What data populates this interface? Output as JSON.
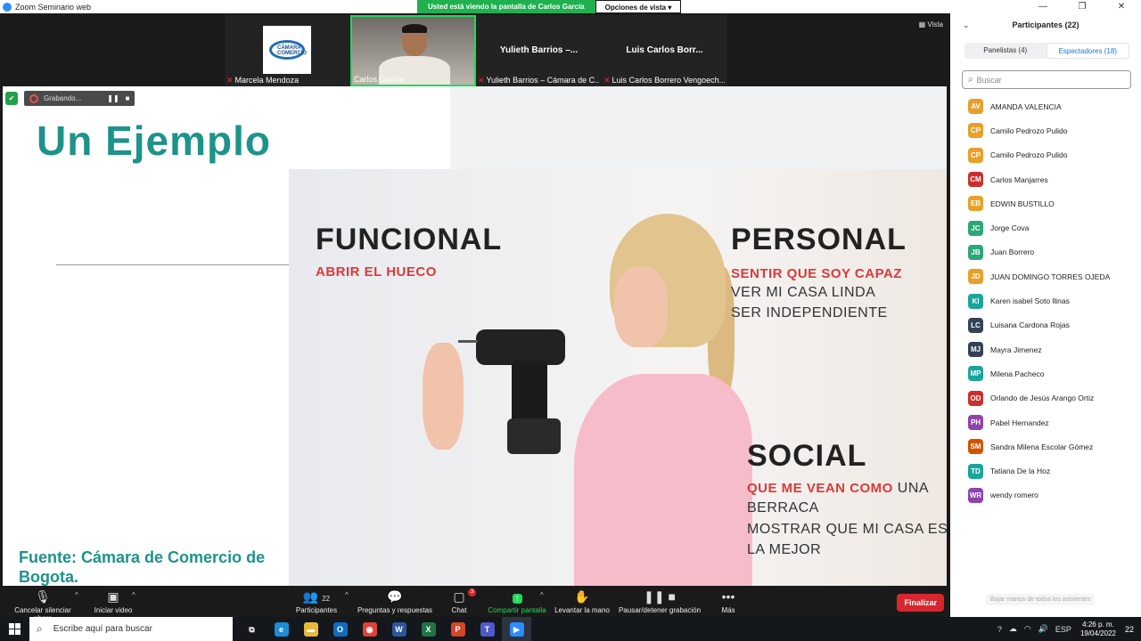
{
  "window": {
    "title": "Zoom Seminario web",
    "controls": [
      "—",
      "❐",
      "✕"
    ]
  },
  "share_bar": {
    "viewing": "Usted está viendo la pantalla de Carlos García",
    "view_options": "Opciones de vista ▾"
  },
  "vista_label": "Vista",
  "thumbnails": [
    {
      "name": "Marcela Mendoza",
      "muted": true,
      "type": "logo",
      "logo_text": "CÁMARA COMERCIO"
    },
    {
      "name": "Carlos García",
      "muted": false,
      "type": "video"
    },
    {
      "name": "Yulieth Barrios – Cámara de C...",
      "big_label": "Yulieth  Barrios –...",
      "muted": true,
      "type": "name"
    },
    {
      "name": "Luis Carlos Borrero Vengoech...",
      "big_label": "Luis Carlos Borr...",
      "muted": true,
      "type": "name"
    }
  ],
  "recording": {
    "label": "Grabando...",
    "pause": "❚❚",
    "stop": "■"
  },
  "slide": {
    "title": "Un Ejemplo",
    "source": "Fuente: Cámara de Comercio de Bogota.",
    "funcional": {
      "heading": "FUNCIONAL",
      "lines": [
        "ABRIR EL HUECO"
      ]
    },
    "personal": {
      "heading": "PERSONAL",
      "red": "SENTIR QUE SOY CAPAZ",
      "lines": [
        "VER MI CASA LINDA",
        "SER INDEPENDIENTE"
      ]
    },
    "social": {
      "heading": "SOCIAL",
      "red": "QUE ME VEAN COMO",
      "red_rest": " UNA",
      "lines": [
        "BERRACA",
        "MOSTRAR QUE MI CASA ES",
        "LA MEJOR"
      ]
    }
  },
  "toolbar": {
    "mute": "Cancelar silenciar ahora",
    "video": "Iniciar video",
    "participants": "Participantes",
    "participants_count": "22",
    "qa": "Preguntas y respuestas",
    "chat": "Chat",
    "chat_badge": "3",
    "share": "Compartir pantalla",
    "raise_hand": "Levantar la mano",
    "pause_rec": "Pausar/detener grabación",
    "more": "Más",
    "end": "Finalizar"
  },
  "panel": {
    "title": "Participantes (22)",
    "tabs": [
      {
        "label": "Panelistas (4)",
        "active": false
      },
      {
        "label": "Espectadores (18)",
        "active": true
      }
    ],
    "search_placeholder": "Buscar",
    "lower_hands": "Bajar manos de todos los asistentes",
    "attendees": [
      {
        "initials": "AV",
        "name": "AMANDA VALENCIA",
        "color": "#e8a02a"
      },
      {
        "initials": "CP",
        "name": "Camilo Pedrozo Pulido",
        "color": "#e8a02a"
      },
      {
        "initials": "CP",
        "name": "Camilo Pedrozo Pulido",
        "color": "#e8a02a"
      },
      {
        "initials": "CM",
        "name": "Carlos Manjarres",
        "color": "#c9302c"
      },
      {
        "initials": "EB",
        "name": "EDWIN BUSTILLO",
        "color": "#e8a02a"
      },
      {
        "initials": "JC",
        "name": "Jorge Cova",
        "color": "#2aa876"
      },
      {
        "initials": "JB",
        "name": "Juan Borrero",
        "color": "#2aa876"
      },
      {
        "initials": "JD",
        "name": "JUAN DOMINGO TORRES OJEDA",
        "color": "#e8a02a"
      },
      {
        "initials": "KI",
        "name": "Karen isabel Soto llinas",
        "color": "#1aa59a"
      },
      {
        "initials": "LC",
        "name": "Luisana Cardona Rojas",
        "color": "#334155"
      },
      {
        "initials": "MJ",
        "name": "Mayra Jimenez",
        "color": "#334155"
      },
      {
        "initials": "MP",
        "name": "Milena Pacheco",
        "color": "#1aa59a"
      },
      {
        "initials": "OD",
        "name": "Orlando de Jesús Arango Ortiz",
        "color": "#c9302c"
      },
      {
        "initials": "PH",
        "name": "Pabel Hernandez",
        "color": "#8e44ad"
      },
      {
        "initials": "SM",
        "name": "Sandra Milena Escolar Gómez",
        "color": "#d35400"
      },
      {
        "initials": "TD",
        "name": "Tatiana De la Hoz",
        "color": "#1aa59a"
      },
      {
        "initials": "WR",
        "name": "wendy romero",
        "color": "#8e44ad"
      }
    ]
  },
  "taskbar": {
    "search_placeholder": "Escribe aquí para buscar",
    "apps": [
      {
        "name": "task-view",
        "glyph": "⧉",
        "color": "transparent"
      },
      {
        "name": "edge",
        "glyph": "e",
        "color": "#1f8bd6"
      },
      {
        "name": "file-explorer",
        "glyph": "▬",
        "color": "#e8b93a"
      },
      {
        "name": "outlook",
        "glyph": "O",
        "color": "#0f6cbd"
      },
      {
        "name": "chrome",
        "glyph": "◉",
        "color": "#db4437"
      },
      {
        "name": "word",
        "glyph": "W",
        "color": "#2b579a"
      },
      {
        "name": "excel",
        "glyph": "X",
        "color": "#217346"
      },
      {
        "name": "powerpoint",
        "glyph": "P",
        "color": "#d24726"
      },
      {
        "name": "teams",
        "glyph": "T",
        "color": "#5059c9"
      },
      {
        "name": "zoom",
        "glyph": "▶",
        "color": "#2d8cff"
      }
    ],
    "lang": "ESP",
    "time": "4:26 p. m.",
    "date": "19/04/2022",
    "notifications": "22"
  }
}
